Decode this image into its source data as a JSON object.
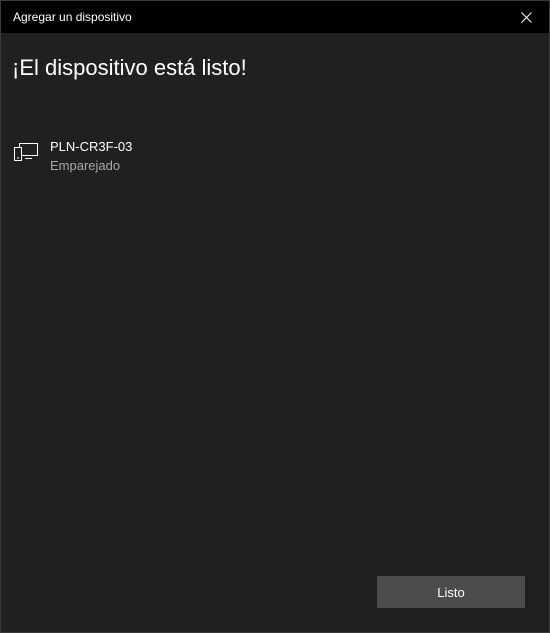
{
  "window": {
    "title": "Agregar un dispositivo",
    "close_icon": "close-icon"
  },
  "main": {
    "heading": "¡El dispositivo está listo!",
    "device": {
      "icon": "display-device-icon",
      "name": "PLN-CR3F-03",
      "status": "Emparejado"
    }
  },
  "footer": {
    "done_label": "Listo"
  },
  "colors": {
    "titlebar_bg": "#000000",
    "window_bg": "#202020",
    "button_bg": "#4c4c4c",
    "status_text": "#a8a8a8"
  }
}
